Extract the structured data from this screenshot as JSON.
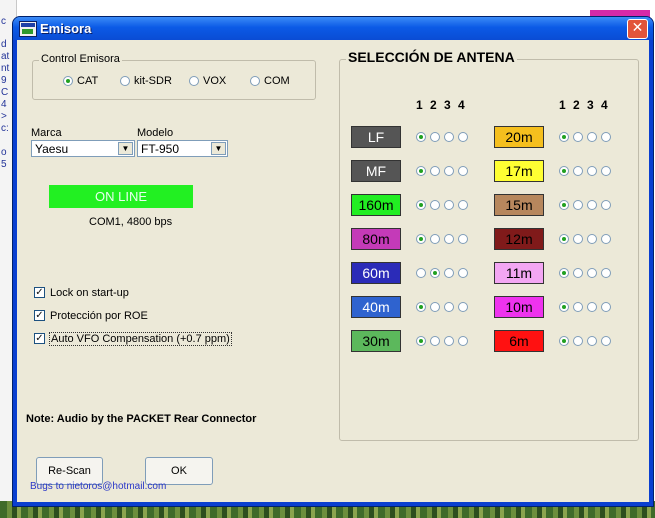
{
  "window": {
    "title": "Emisora",
    "close_glyph": "✕"
  },
  "background": {
    "left_glyphs": [
      "c",
      "d",
      "at",
      "nt",
      "9",
      "C",
      "4",
      ">",
      "c:",
      "o",
      "5"
    ]
  },
  "control": {
    "legend": "Control Emisora",
    "options": [
      {
        "label": "CAT",
        "selected": true
      },
      {
        "label": "kit-SDR",
        "selected": false
      },
      {
        "label": "VOX",
        "selected": false
      },
      {
        "label": "COM",
        "selected": false
      }
    ]
  },
  "marca": {
    "label": "Marca",
    "value": "Yaesu"
  },
  "modelo": {
    "label": "Modelo",
    "value": "FT-950"
  },
  "status": {
    "text": "ON LINE",
    "port": "COM1, 4800 bps"
  },
  "checkboxes": [
    {
      "label": "Lock on start-up",
      "checked": true
    },
    {
      "label": "Protección por ROE",
      "checked": true
    },
    {
      "label": "Auto VFO Compensation (+0.7 ppm)",
      "checked": true
    }
  ],
  "note": "Note: Audio by the PACKET Rear Connector",
  "buttons": {
    "rescan": "Re-Scan",
    "ok": "OK"
  },
  "bugs_link": "Bugs to nietoros@hotmail.com",
  "antenna": {
    "legend": "SELECCIÓN DE ANTENA",
    "column_header": "1 2 3 4",
    "left": [
      {
        "band": "LF",
        "bg": "#555555",
        "fg": "#ffffff",
        "selected": 1
      },
      {
        "band": "MF",
        "bg": "#555555",
        "fg": "#ffffff",
        "selected": 1
      },
      {
        "band": "160m",
        "bg": "#22ee22",
        "fg": "#000000",
        "selected": 1
      },
      {
        "band": "80m",
        "bg": "#c43ab8",
        "fg": "#000000",
        "selected": 1
      },
      {
        "band": "60m",
        "bg": "#2b2bb8",
        "fg": "#ffffff",
        "selected": 2
      },
      {
        "band": "40m",
        "bg": "#2f63cf",
        "fg": "#ffffff",
        "selected": 1
      },
      {
        "band": "30m",
        "bg": "#5cb85c",
        "fg": "#000000",
        "selected": 1
      }
    ],
    "right": [
      {
        "band": "20m",
        "bg": "#f5bf1e",
        "fg": "#000000",
        "selected": 1
      },
      {
        "band": "17m",
        "bg": "#ffff33",
        "fg": "#000000",
        "selected": 1
      },
      {
        "band": "15m",
        "bg": "#b7875d",
        "fg": "#000000",
        "selected": 1
      },
      {
        "band": "12m",
        "bg": "#801a1a",
        "fg": "#000000",
        "selected": 1
      },
      {
        "band": "11m",
        "bg": "#f3a6f3",
        "fg": "#000000",
        "selected": 1
      },
      {
        "band": "10m",
        "bg": "#ee33ee",
        "fg": "#000000",
        "selected": 1
      },
      {
        "band": "6m",
        "bg": "#ff1111",
        "fg": "#000000",
        "selected": 1
      }
    ]
  }
}
